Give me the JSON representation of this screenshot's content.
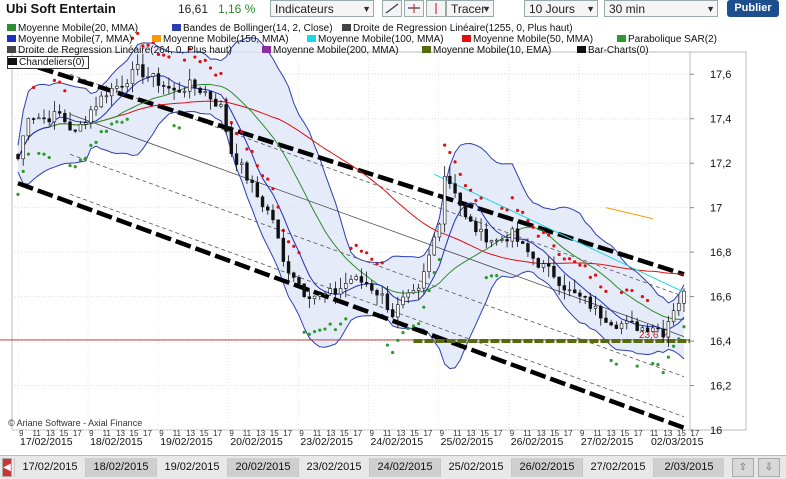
{
  "toolbar": {
    "instrument": "Ubi Soft Entertain",
    "price": "16,61",
    "change": "1,16 %",
    "indicators_label": "Indicateurs",
    "tracer_label": "Tracer",
    "period_value": "10 Jours",
    "interval_value": "30 min",
    "publish_label": "Publier"
  },
  "colors": {
    "candle": "#111111",
    "sma20": "#2e8b2e",
    "bollinger": "#2d3fb0",
    "bollinger_fill": "#dfe6f7",
    "regression": "#444444",
    "sma7": "#1f2fbf",
    "sma150": "#ff9900",
    "sma100": "#19d7e6",
    "sma50": "#e01010",
    "parabolic": "#2e9a2e",
    "sma200": "#8a2da0",
    "ema10": "#556b10",
    "fib": "#c02020"
  },
  "legend": [
    {
      "label": "Moyenne Mobile(20, MMA)",
      "color_key": "sma20"
    },
    {
      "label": "Bandes de Bollinger(14, 2, Close)",
      "color_key": "bollinger"
    },
    {
      "label": "Droite de Regression Linéaire(1255, 0, Plus haut)",
      "color_key": "regression"
    },
    {
      "label": "Moyenne Mobile(7, MMA)",
      "color_key": "sma7"
    },
    {
      "label": "Moyenne Mobile(150, MMA)",
      "color_key": "sma150"
    },
    {
      "label": "Moyenne Mobile(100, MMA)",
      "color_key": "sma100"
    },
    {
      "label": "Moyenne Mobile(50, MMA)",
      "color_key": "sma50"
    },
    {
      "label": "Parabolique SAR(2)",
      "color_key": "parabolic"
    },
    {
      "label": "Droite de Regression Linéaire(264, 0, Plus haut)",
      "color_key": "regression"
    },
    {
      "label": "Moyenne Mobile(200, MMA)",
      "color_key": "sma200"
    },
    {
      "label": "Moyenne Mobile(10, EMA)",
      "color_key": "ema10"
    },
    {
      "label": "Bar-Charts(0)",
      "color_key": "candle"
    },
    {
      "label": "Chandeliers(0)",
      "color_key": "candle"
    }
  ],
  "copyright": "© Ariane Software - Axial Finance",
  "fib_label": "23,6 %",
  "navigator": {
    "dates": [
      "17/02/2015",
      "18/02/2015",
      "19/02/2015",
      "20/02/2015",
      "23/02/2015",
      "24/02/2015",
      "25/02/2015",
      "26/02/2015",
      "27/02/2015",
      "2/03/2015"
    ],
    "highlight": [
      false,
      true,
      false,
      true,
      false,
      true,
      false,
      true,
      false,
      true
    ]
  },
  "chart_data": {
    "type": "candlestick",
    "ylim": [
      16.0,
      17.7
    ],
    "y_ticks": [
      "16",
      "16,2",
      "16,4",
      "16,6",
      "16,8",
      "17",
      "17,2",
      "17,4",
      "17,6"
    ],
    "days": [
      "17/02/2015",
      "18/02/2015",
      "19/02/2015",
      "20/02/2015",
      "23/02/2015",
      "24/02/2015",
      "25/02/2015",
      "26/02/2015",
      "27/02/2015",
      "02/03/2015"
    ],
    "hour_ticks": [
      "9",
      "11",
      "13",
      "15",
      "17"
    ],
    "final_hour_ticks": [
      "11",
      "13",
      "15",
      "17"
    ],
    "close_path": [
      {
        "i": 0,
        "v": 17.22
      },
      {
        "i": 2,
        "v": 17.42
      },
      {
        "i": 5,
        "v": 17.4
      },
      {
        "i": 8,
        "v": 17.42
      },
      {
        "i": 11,
        "v": 17.33
      },
      {
        "i": 14,
        "v": 17.44
      },
      {
        "i": 17,
        "v": 17.52
      },
      {
        "i": 20,
        "v": 17.56
      },
      {
        "i": 23,
        "v": 17.62
      },
      {
        "i": 26,
        "v": 17.58
      },
      {
        "i": 30,
        "v": 17.52
      },
      {
        "i": 33,
        "v": 17.55
      },
      {
        "i": 36,
        "v": 17.52
      },
      {
        "i": 39,
        "v": 17.45
      },
      {
        "i": 41,
        "v": 17.25
      },
      {
        "i": 43,
        "v": 17.18
      },
      {
        "i": 46,
        "v": 17.05
      },
      {
        "i": 49,
        "v": 16.95
      },
      {
        "i": 51,
        "v": 16.75
      },
      {
        "i": 53,
        "v": 16.7
      },
      {
        "i": 55,
        "v": 16.62
      },
      {
        "i": 58,
        "v": 16.6
      },
      {
        "i": 61,
        "v": 16.62
      },
      {
        "i": 64,
        "v": 16.68
      },
      {
        "i": 67,
        "v": 16.66
      },
      {
        "i": 70,
        "v": 16.6
      },
      {
        "i": 72,
        "v": 16.52
      },
      {
        "i": 74,
        "v": 16.58
      },
      {
        "i": 77,
        "v": 16.62
      },
      {
        "i": 79,
        "v": 16.78
      },
      {
        "i": 81,
        "v": 16.95
      },
      {
        "i": 82,
        "v": 17.15
      },
      {
        "i": 84,
        "v": 17.08
      },
      {
        "i": 86,
        "v": 16.95
      },
      {
        "i": 89,
        "v": 16.88
      },
      {
        "i": 92,
        "v": 16.85
      },
      {
        "i": 95,
        "v": 16.88
      },
      {
        "i": 97,
        "v": 16.82
      },
      {
        "i": 100,
        "v": 16.75
      },
      {
        "i": 103,
        "v": 16.7
      },
      {
        "i": 106,
        "v": 16.62
      },
      {
        "i": 109,
        "v": 16.58
      },
      {
        "i": 112,
        "v": 16.52
      },
      {
        "i": 115,
        "v": 16.48
      },
      {
        "i": 118,
        "v": 16.47
      },
      {
        "i": 120,
        "v": 16.46
      },
      {
        "i": 122,
        "v": 16.47
      },
      {
        "i": 124,
        "v": 16.44
      },
      {
        "i": 126,
        "v": 16.55
      },
      {
        "i": 128,
        "v": 16.61
      }
    ],
    "channels": {
      "upper_thick": [
        [
          17.66,
          0
        ],
        [
          16.7,
          128
        ]
      ],
      "lower_thick": [
        [
          17.11,
          0
        ],
        [
          16.01,
          128
        ]
      ],
      "regression_mid": [
        [
          17.42,
          10
        ],
        [
          16.42,
          128
        ]
      ],
      "dashed_offsets": [
        0.18,
        -0.18,
        -0.36
      ]
    },
    "fib_level": 16.405,
    "ema10_flat": 16.4,
    "sma100_segment": [
      [
        17.15,
        80
      ],
      [
        16.62,
        128
      ]
    ],
    "sma150_segment": [
      [
        17.0,
        113
      ],
      [
        16.95,
        122
      ]
    ]
  }
}
